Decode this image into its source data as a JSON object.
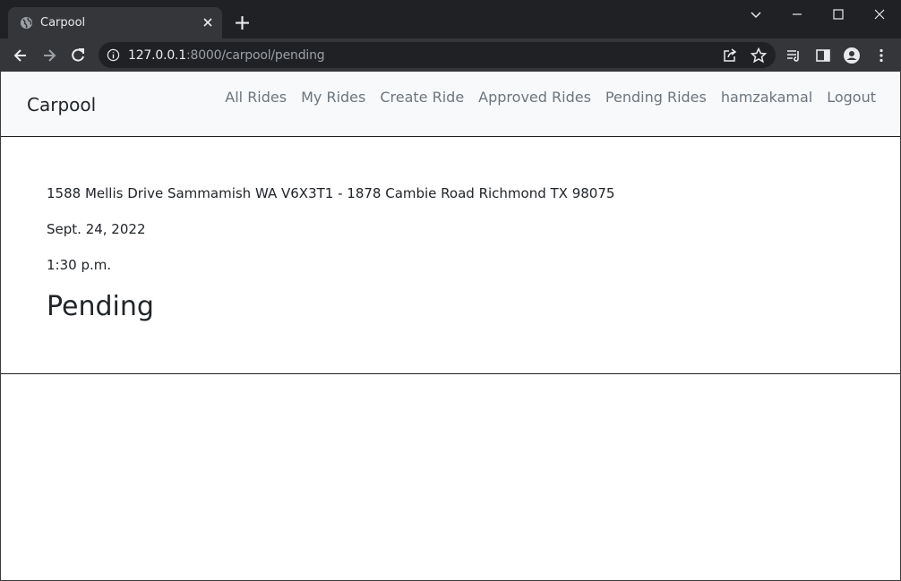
{
  "browser": {
    "tab": {
      "title": "Carpool",
      "favicon": "globe-icon"
    },
    "address": {
      "host": "127.0.0.1",
      "path": ":8000/carpool/pending"
    },
    "toolbar_icons": [
      "back-icon",
      "forward-icon",
      "reload-icon",
      "site-info-icon",
      "share-icon",
      "bookmark-star-icon",
      "reading-list-icon",
      "side-panel-icon",
      "profile-icon",
      "menu-icon"
    ],
    "colors": {
      "chrome_dark": "#202124",
      "chrome_tab": "#35363a",
      "text": "#e8eaed",
      "text_dim": "#9aa0a6"
    }
  },
  "navbar": {
    "brand": "Carpool",
    "links": [
      "All Rides",
      "My Rides",
      "Create Ride",
      "Approved Rides",
      "Pending Rides",
      "hamzakamal",
      "Logout"
    ],
    "colors": {
      "background": "#f8f9fa",
      "link": "#6c757d",
      "brand": "#212529"
    }
  },
  "ride": {
    "route": "1588 Mellis Drive Sammamish WA V6X3T1 - 1878 Cambie Road Richmond TX 98075",
    "date": "Sept. 24, 2022",
    "time": "1:30 p.m.",
    "status": "Pending"
  }
}
